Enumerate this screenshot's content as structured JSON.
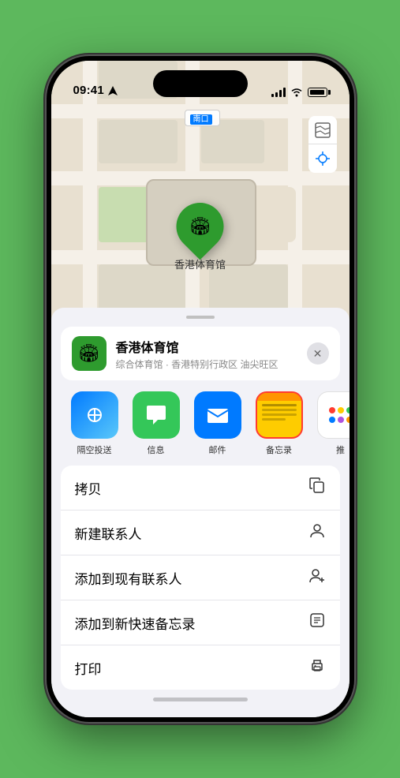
{
  "status_bar": {
    "time": "09:41",
    "location_arrow": "▶"
  },
  "map": {
    "label": "南口",
    "pin_emoji": "🏟",
    "pin_label": "香港体育馆",
    "control_map": "🗺",
    "control_location": "➤"
  },
  "venue_card": {
    "name": "香港体育馆",
    "description": "综合体育馆 · 香港特别行政区 油尖旺区",
    "icon_emoji": "🏟"
  },
  "share_items": [
    {
      "id": "airdrop",
      "label": "隔空投送"
    },
    {
      "id": "messages",
      "label": "信息",
      "emoji": "💬"
    },
    {
      "id": "mail",
      "label": "邮件",
      "emoji": "✉️"
    },
    {
      "id": "notes",
      "label": "备忘录"
    },
    {
      "id": "more",
      "label": "推"
    }
  ],
  "action_items": [
    {
      "label": "拷贝",
      "icon": "copy"
    },
    {
      "label": "新建联系人",
      "icon": "person"
    },
    {
      "label": "添加到现有联系人",
      "icon": "person-add"
    },
    {
      "label": "添加到新快速备忘录",
      "icon": "note"
    },
    {
      "label": "打印",
      "icon": "printer"
    }
  ]
}
